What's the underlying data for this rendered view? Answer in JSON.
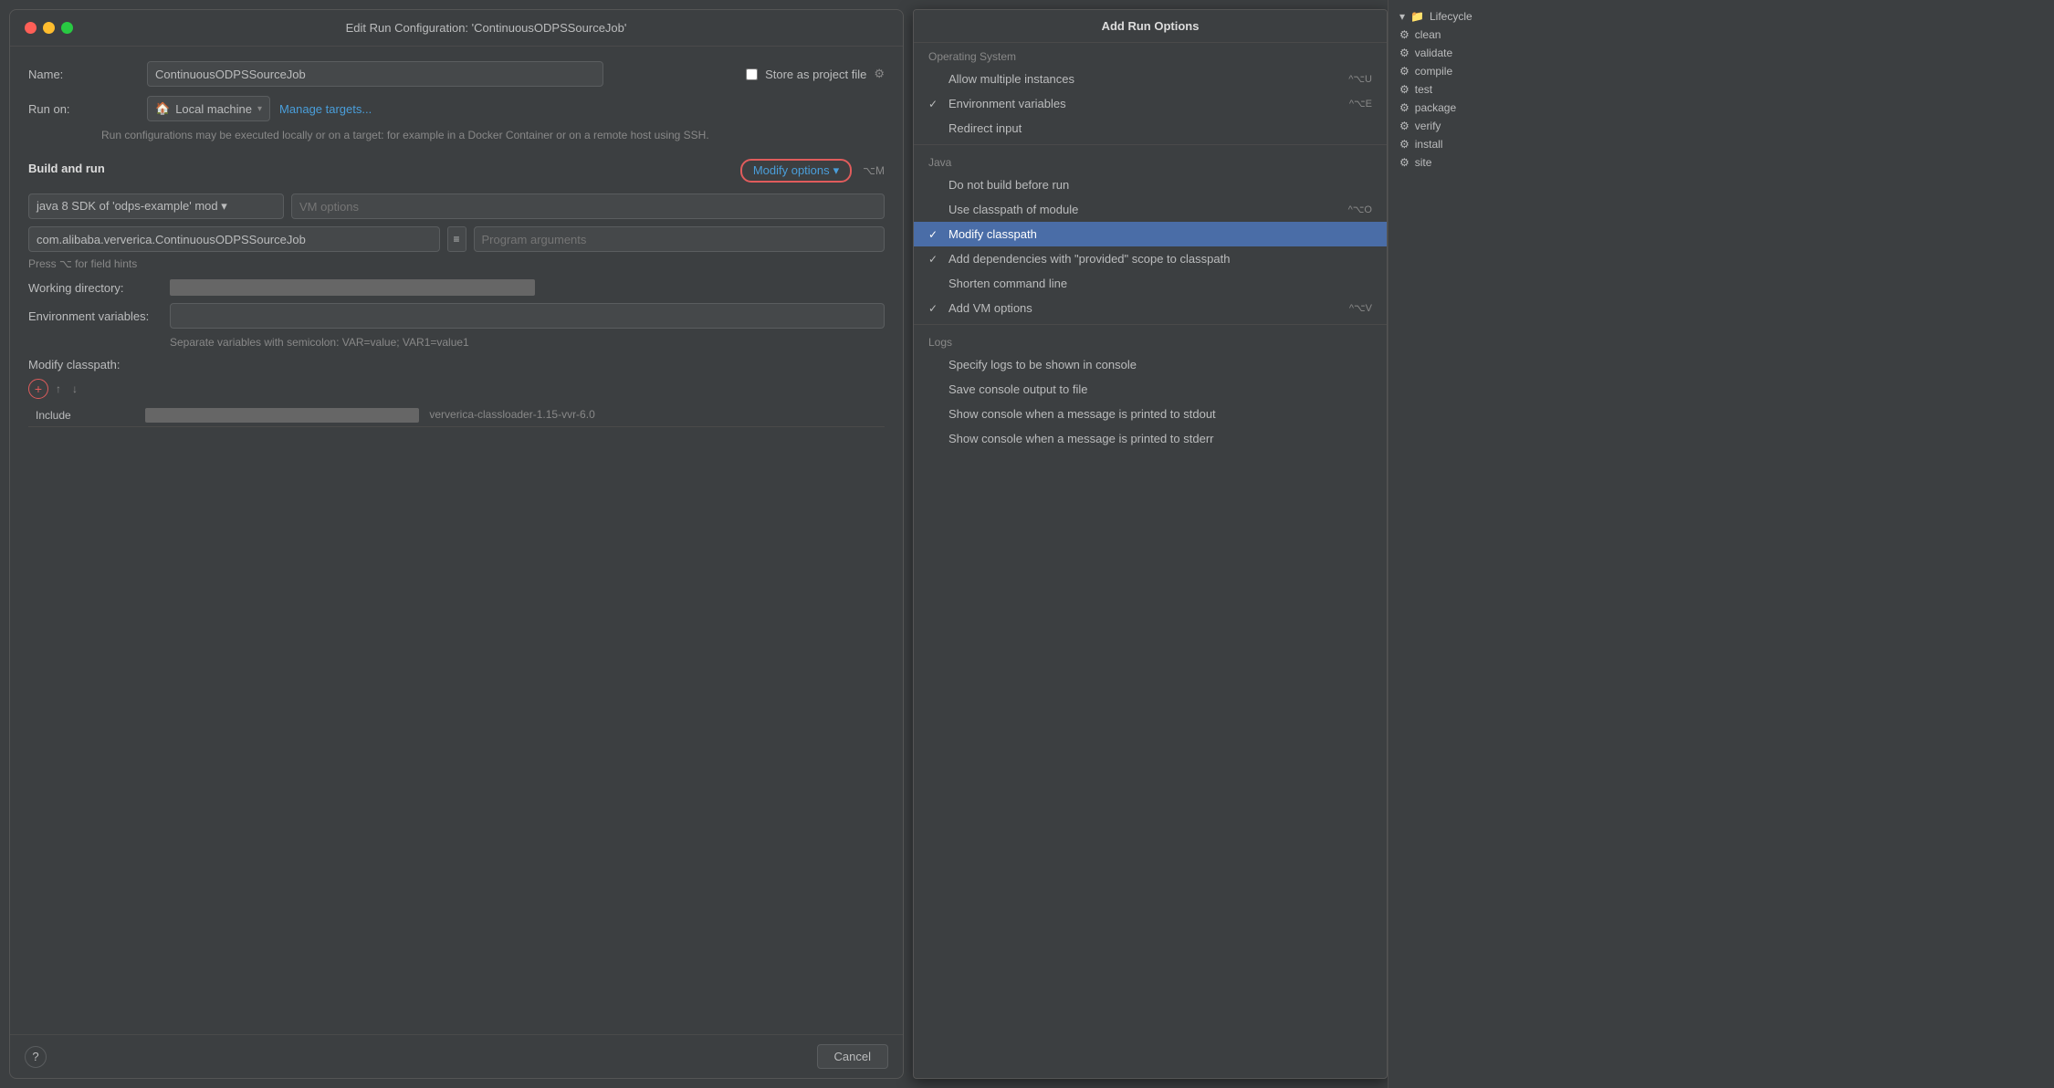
{
  "dialog": {
    "title": "Edit Run Configuration: 'ContinuousODPSSourceJob'",
    "name_label": "Name:",
    "name_value": "ContinuousODPSSourceJob",
    "store_as_project_file": "Store as project file",
    "run_on_label": "Run on:",
    "local_machine": "Local machine",
    "manage_targets": "Manage targets...",
    "run_hint": "Run configurations may be executed locally or on a target: for\nexample in a Docker Container or on a remote host using SSH.",
    "build_and_run": "Build and run",
    "modify_options": "Modify options",
    "modify_shortcut": "⌥M",
    "sdk_value": "java 8 SDK of 'odps-example' mod ▾",
    "vm_options_placeholder": "VM options",
    "class_value": "com.alibaba.ververica.ContinuousODPSSourceJob",
    "program_args_placeholder": "Program arguments",
    "press_hint": "Press ⌥ for field hints",
    "working_dir_label": "Working directory:",
    "env_vars_label": "Environment variables:",
    "env_hint": "Separate variables with semicolon: VAR=value; VAR1=value1",
    "modify_classpath": "Modify classpath:",
    "include_col": "Include",
    "classpath_file": "ververica-classloader-1.15-vvr-6.0",
    "cancel_btn": "Cancel",
    "help_btn": "?"
  },
  "options_panel": {
    "title": "Add Run Options",
    "sections": [
      {
        "name": "Operating System",
        "items": [
          {
            "check": "",
            "label": "Allow multiple instances",
            "shortcut": "^⌥U"
          },
          {
            "check": "✓",
            "label": "Environment variables",
            "shortcut": "^⌥E"
          },
          {
            "check": "",
            "label": "Redirect input",
            "shortcut": ""
          }
        ]
      },
      {
        "name": "Java",
        "items": [
          {
            "check": "",
            "label": "Do not build before run",
            "shortcut": ""
          },
          {
            "check": "",
            "label": "Use classpath of module",
            "shortcut": "^⌥O"
          },
          {
            "check": "✓",
            "label": "Modify classpath",
            "shortcut": "",
            "active": true
          },
          {
            "check": "✓",
            "label": "Add dependencies with \"provided\" scope to classpath",
            "shortcut": ""
          },
          {
            "check": "",
            "label": "Shorten command line",
            "shortcut": ""
          },
          {
            "check": "✓",
            "label": "Add VM options",
            "shortcut": "^⌥V"
          }
        ]
      },
      {
        "name": "Logs",
        "items": [
          {
            "check": "",
            "label": "Specify logs to be shown in console",
            "shortcut": ""
          },
          {
            "check": "",
            "label": "Save console output to file",
            "shortcut": ""
          },
          {
            "check": "",
            "label": "Show console when a message is printed to stdout",
            "shortcut": ""
          },
          {
            "check": "",
            "label": "Show console when a message is printed to stderr",
            "shortcut": ""
          }
        ]
      }
    ]
  },
  "sidebar": {
    "items": [
      {
        "icon": "⚙",
        "label": "clean"
      },
      {
        "icon": "⚙",
        "label": "validate"
      },
      {
        "icon": "⚙",
        "label": "compile"
      },
      {
        "icon": "⚙",
        "label": "test"
      },
      {
        "icon": "⚙",
        "label": "package"
      },
      {
        "icon": "⚙",
        "label": "verify"
      },
      {
        "icon": "⚙",
        "label": "install"
      },
      {
        "icon": "⚙",
        "label": "site"
      }
    ],
    "header_icon": "▾",
    "header_label": "Lifecycle"
  }
}
